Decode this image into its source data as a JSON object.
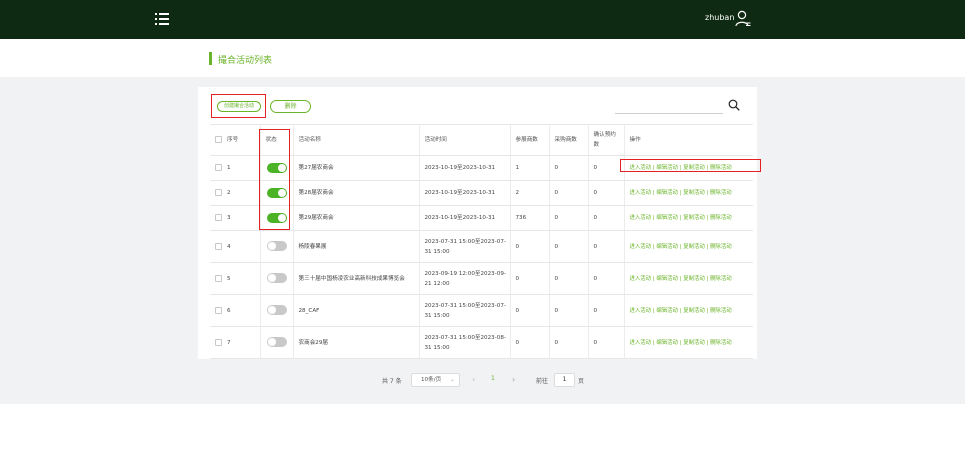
{
  "header": {
    "user_name": "zhuban"
  },
  "page_title": "撮合活动列表",
  "toolbar": {
    "create_label": "创建撮合活动",
    "delete_label": "删除"
  },
  "table": {
    "columns": [
      "序号",
      "状态",
      "活动名称",
      "活动时间",
      "参展商数",
      "采购商数",
      "确认预约数",
      "操作"
    ],
    "rows": [
      {
        "no": "1",
        "enabled": true,
        "name": "第27届农商会",
        "time": "2023-10-19至2023-10-31",
        "exhibitors": "1",
        "buyers": "0",
        "confirmed": "0"
      },
      {
        "no": "2",
        "enabled": true,
        "name": "第28届农商会",
        "time": "2023-10-19至2023-10-31",
        "exhibitors": "2",
        "buyers": "0",
        "confirmed": "0"
      },
      {
        "no": "3",
        "enabled": true,
        "name": "第29届农商会",
        "time": "2023-10-19至2023-10-31",
        "exhibitors": "736",
        "buyers": "0",
        "confirmed": "0"
      },
      {
        "no": "4",
        "enabled": false,
        "name": "杨陵春果展",
        "time": "2023-07-31 15:00至2023-07-31 15:00",
        "exhibitors": "0",
        "buyers": "0",
        "confirmed": "0"
      },
      {
        "no": "5",
        "enabled": false,
        "name": "第三十届中国杨凌农业高新科技成果博览会",
        "time": "2023-09-19 12:00至2023-09-21 12:00",
        "exhibitors": "0",
        "buyers": "0",
        "confirmed": "0"
      },
      {
        "no": "6",
        "enabled": false,
        "name": "28_CAF",
        "time": "2023-07-31 15:00至2023-07-31 15:00",
        "exhibitors": "0",
        "buyers": "0",
        "confirmed": "0"
      },
      {
        "no": "7",
        "enabled": false,
        "name": "农商会29届",
        "time": "2023-07-31 15:00至2023-08-31 15:00",
        "exhibitors": "0",
        "buyers": "0",
        "confirmed": "0"
      }
    ],
    "actions": {
      "enter": "进入活动",
      "edit": "编辑活动",
      "copy": "复制活动",
      "delete": "删除活动",
      "separator": "|"
    }
  },
  "pagination": {
    "total": "共 7 条",
    "page_size": "10条/页",
    "current_page": "1",
    "goto_label": "前往",
    "goto_value": "1",
    "page_suffix": "页"
  },
  "colors": {
    "topbar": "#0f2a12",
    "accent": "#6ab42a",
    "switch_on": "#4cb327",
    "highlight_box": "#e52222"
  }
}
